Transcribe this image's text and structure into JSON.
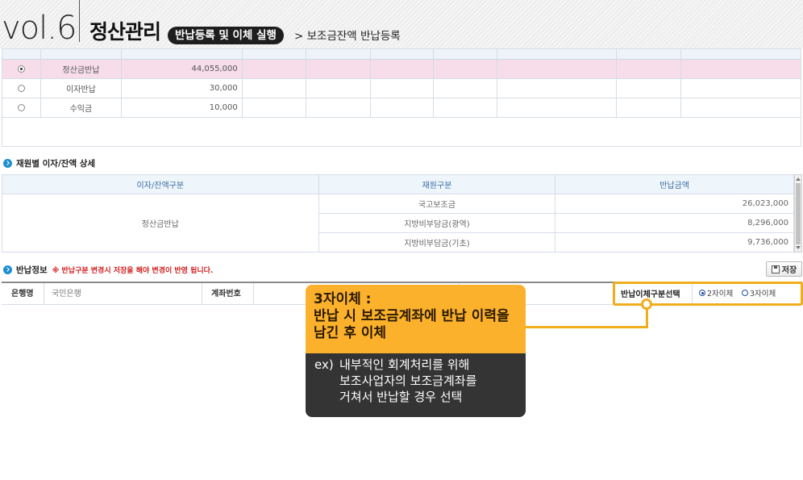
{
  "header": {
    "vol": "vol.6",
    "title": "정산관리",
    "pill": "반납등록 및 이체 실행",
    "breadcrumb": "> 보조금잔액 반납등록"
  },
  "top_table": {
    "rows": [
      {
        "name": "정산금반납",
        "amount": "44,055,000",
        "selected": true
      },
      {
        "name": "이자반납",
        "amount": "30,000",
        "selected": false
      },
      {
        "name": "수익금",
        "amount": "10,000",
        "selected": false
      }
    ]
  },
  "detail_section": {
    "title": "재원별 이자/잔액 상세",
    "columns": [
      "이자/잔액구분",
      "재원구분",
      "반납금액"
    ],
    "group_label": "정산금반납",
    "rows": [
      {
        "source": "국고보조금",
        "amount": "26,023,000"
      },
      {
        "source": "지방비부담금(광역)",
        "amount": "8,296,000"
      },
      {
        "source": "지방비부담금(기초)",
        "amount": "9,736,000"
      }
    ]
  },
  "refund_section": {
    "title": "반납정보",
    "note": "※ 반납구분 변경시 저장을 해야 변경이 반영 됩니다.",
    "save_label": "저장",
    "bank_label": "은행명",
    "bank_value": "국민은행",
    "account_label": "계좌번호",
    "transfer_choice_label": "반납이체구분선택",
    "options": [
      {
        "label": "2자이체",
        "selected": true
      },
      {
        "label": "3자이체",
        "selected": false
      }
    ]
  },
  "callout": {
    "title": "3자이체 :",
    "body": [
      "반납 시 보조금계좌에 반납 이력을",
      "남긴 후 이체"
    ],
    "ex_prefix": "ex)",
    "ex_lines": [
      "내부적인 회계처리를 위해",
      "보조사업자의 보조금계좌를",
      "거쳐서 반납할 경우 선택"
    ]
  },
  "colors": {
    "accent_yellow": "#fbb12b",
    "callout_dark": "#343434",
    "selected_row": "#f6dde9",
    "bullet_blue": "#1d8fd0",
    "note_red": "#d12020"
  }
}
